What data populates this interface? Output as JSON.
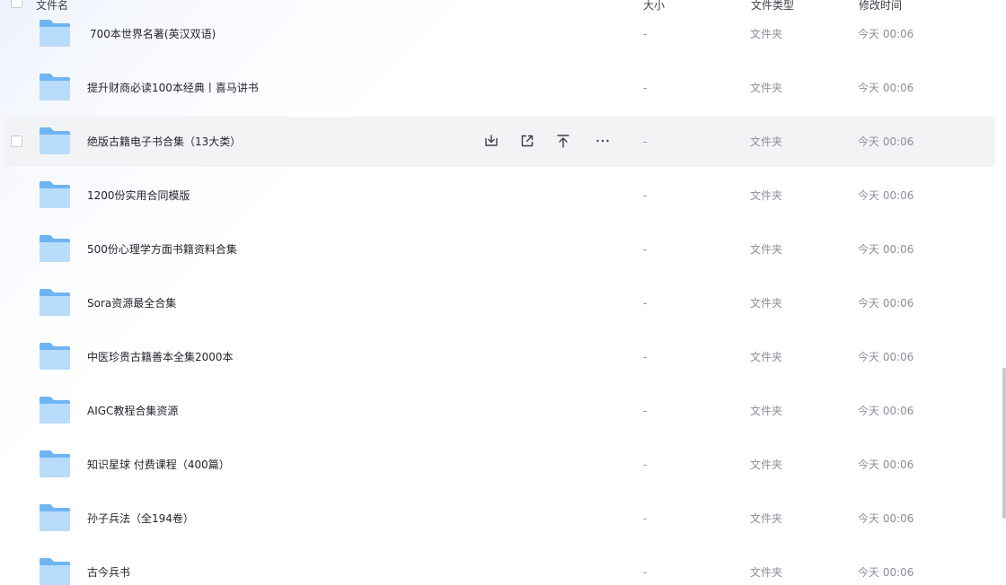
{
  "header": {
    "name": "文件名",
    "size": "大小",
    "type": "文件类型",
    "modified": "修改时间"
  },
  "rows": [
    {
      "name": "700本世界名著(英汉双语)",
      "size": "-",
      "type": "文件夹",
      "time": "今天 00:06"
    },
    {
      "name": "提升财商必读100本经典丨喜马讲书",
      "size": "-",
      "type": "文件夹",
      "time": "今天 00:06"
    },
    {
      "name": "绝版古籍电子书合集（13大类）",
      "size": "-",
      "type": "文件夹",
      "time": "今天 00:06"
    },
    {
      "name": "1200份实用合同模版",
      "size": "-",
      "type": "文件夹",
      "time": "今天 00:06"
    },
    {
      "name": "500份心理学方面书籍资料合集",
      "size": "-",
      "type": "文件夹",
      "time": "今天 00:06"
    },
    {
      "name": "Sora资源最全合集",
      "size": "-",
      "type": "文件夹",
      "time": "今天 00:06"
    },
    {
      "name": "中医珍贵古籍善本全集2000本",
      "size": "-",
      "type": "文件夹",
      "time": "今天 00:06"
    },
    {
      "name": "AIGC教程合集资源",
      "size": "-",
      "type": "文件夹",
      "time": "今天 00:06"
    },
    {
      "name": "知识星球 付费课程（400篇）",
      "size": "-",
      "type": "文件夹",
      "time": "今天 00:06"
    },
    {
      "name": "孙子兵法（全194卷）",
      "size": "-",
      "type": "文件夹",
      "time": "今天 00:06"
    },
    {
      "name": "古今兵书",
      "size": "-",
      "type": "文件夹",
      "time": "今天 00:06"
    }
  ],
  "hover_actions": {
    "download": "download-icon",
    "share": "share-icon",
    "move_top": "move-to-top-icon",
    "more": "more-icon"
  },
  "colors": {
    "hover_row": "#f2f3f5",
    "folder_light": "#b9dcfb",
    "folder_dark": "#6fb5f3",
    "muted_text": "#8a8f99"
  }
}
